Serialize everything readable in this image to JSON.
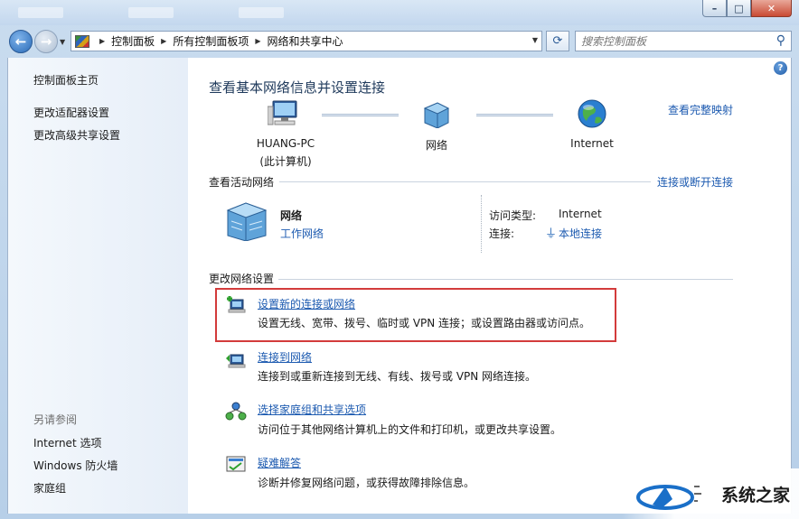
{
  "window": {
    "buttons": {
      "minimize": "–",
      "maximize": "□",
      "close": "✕"
    }
  },
  "address": {
    "crumbs": [
      "控制面板",
      "所有控制面板项",
      "网络和共享中心"
    ],
    "search_placeholder": "搜索控制面板"
  },
  "sidebar": {
    "home": "控制面板主页",
    "links": [
      "更改适配器设置",
      "更改高级共享设置"
    ],
    "see_also_title": "另请参阅",
    "see_also": [
      "Internet 选项",
      "Windows 防火墙",
      "家庭组"
    ]
  },
  "main": {
    "help": "?",
    "heading": "查看基本网络信息并设置连接",
    "full_map_link": "查看完整映射",
    "network_map": {
      "computer_name": "HUANG-PC",
      "computer_sub": "(此计算机)",
      "network": "网络",
      "internet": "Internet"
    },
    "active_networks": {
      "title": "查看活动网络",
      "connect_link": "连接或断开连接",
      "network_name": "网络",
      "network_type": "工作网络",
      "access_type_label": "访问类型:",
      "access_type_value": "Internet",
      "connection_label": "连接:",
      "connection_value": "本地连接"
    },
    "change_settings": {
      "title": "更改网络设置",
      "tasks": [
        {
          "title": "设置新的连接或网络",
          "desc": "设置无线、宽带、拨号、临时或 VPN 连接；或设置路由器或访问点。"
        },
        {
          "title": "连接到网络",
          "desc": "连接到或重新连接到无线、有线、拨号或 VPN 网络连接。"
        },
        {
          "title": "选择家庭组和共享选项",
          "desc": "访问位于其他网络计算机上的文件和打印机，或更改共享设置。"
        },
        {
          "title": "疑难解答",
          "desc": "诊断并修复网络问题，或获得故障排除信息。"
        }
      ]
    }
  },
  "watermark": {
    "text": "系统之家"
  },
  "colors": {
    "link": "#1c5ab0",
    "highlight": "#d33b3b",
    "heading": "#1e395b"
  }
}
